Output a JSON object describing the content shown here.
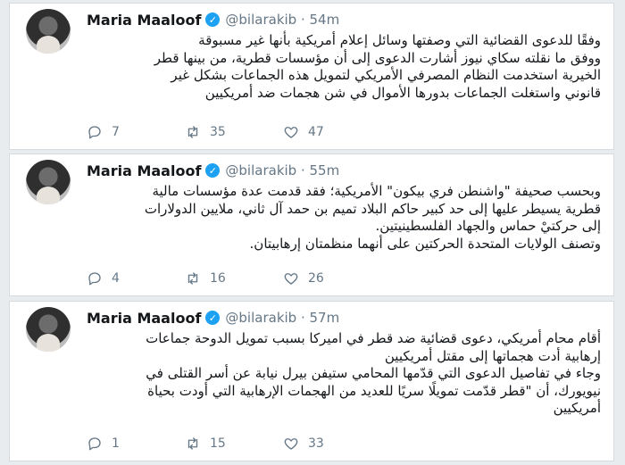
{
  "tweets": [
    {
      "name": "Maria Maaloof",
      "handle": "@bilarakib",
      "time": "54m",
      "lines": [
        "وفقًا للدعوى القضائية التي وصفتها وسائل إعلام أمريكية بأنها غير مسبوقة",
        "ووفق ما نقلته سكاي نيوز أشارت الدعوى إلى أن مؤسسات قطرية، من بينها قطر",
        "الخيرية استخدمت النظام المصرفي الأمريكي لتمويل هذه الجماعات بشكل غير",
        "قانوني واستغلت الجماعات بدورها الأموال في شن هجمات ضد أمريكيين"
      ],
      "replies": "7",
      "retweets": "35",
      "likes": "47"
    },
    {
      "name": "Maria Maaloof",
      "handle": "@bilarakib",
      "time": "55m",
      "lines": [
        "وبحسب صحيفة \"واشنطن فري بيكون\" الأمريكية؛ فقد قدمت عدة مؤسسات مالية",
        "قطرية يسيطر عليها إلى حد كبير حاكم البلاد تميم بن حمد آل ثاني، ملايين الدولارات",
        "إلى حركتيْ حماس والجهاد الفلسطينيتين.",
        "وتصنف الولايات المتحدة الحركتين على أنهما منظمتان إرهابيتان."
      ],
      "replies": "4",
      "retweets": "16",
      "likes": "26"
    },
    {
      "name": "Maria Maaloof",
      "handle": "@bilarakib",
      "time": "57m",
      "lines": [
        "أقام محام أمريكي، دعوى قضائية ضد قطر في اميركا بسبب تمويل الدوحة جماعات",
        "إرهابية أدت هجماتها إلى مقتل أمريكيين",
        "وجاء في تفاصيل الدعوى التي قدّمها المحامي ستيفن بيرل نيابة عن أسر القتلى في",
        "نيويورك، أن \"قطر قدّمت تمويلًا سريًا للعديد من الهجمات الإرهابية التي أودت بحياة",
        "أمريكيين"
      ],
      "replies": "1",
      "retweets": "15",
      "likes": "33"
    }
  ]
}
